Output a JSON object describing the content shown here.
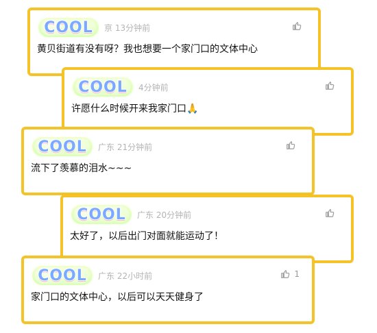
{
  "comments": [
    {
      "logo_text": "COOL",
      "meta": "亰 13分钟前",
      "text": "黄贝街道有没有呀？我也想要一个家门口的文体中心",
      "like_count": ""
    },
    {
      "logo_text": "COOL",
      "meta": "4分钟前",
      "text": "许愿什么时候开来我家门口🙏",
      "like_count": ""
    },
    {
      "logo_text": "COOL",
      "meta": "广东 21分钟前",
      "text": "流下了羡慕的泪水~~~",
      "like_count": ""
    },
    {
      "logo_text": "COOL",
      "meta": "广东 20分钟前",
      "text": "太好了，以后出门对面就能运动了！",
      "like_count": ""
    },
    {
      "logo_text": "COOL",
      "meta": "广东 22小时前",
      "text": "家门口的文体中心，以后可以天天健身了",
      "like_count": "1"
    }
  ],
  "colors": {
    "border": "#f3c328",
    "meta_text": "#b4b4b4",
    "comment_text": "#111111",
    "icon": "#9a9a9a"
  },
  "icons": {
    "like": "thumbs-up-icon"
  }
}
